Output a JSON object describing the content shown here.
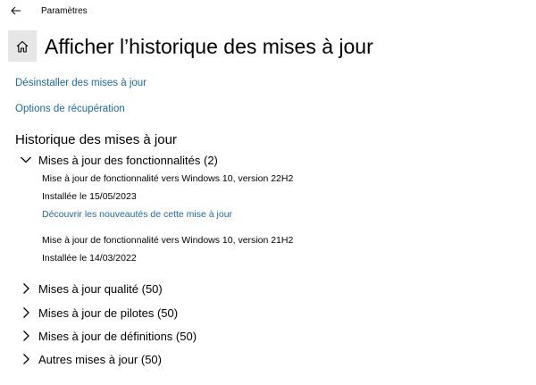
{
  "titlebar": {
    "back_icon": "back-arrow-icon",
    "app_title": "Paramètres"
  },
  "header": {
    "home_icon": "home-icon",
    "title": "Afficher l’historique des mises à jour"
  },
  "links": {
    "uninstall": "Désinstaller des mises à jour",
    "recovery": "Options de récupération"
  },
  "history": {
    "title": "Historique des mises à jour",
    "groups": [
      {
        "label": "Mises à jour des fonctionnalités (2)",
        "expanded": true,
        "items": [
          {
            "name": "Mise à jour de fonctionnalité vers Windows 10, version 22H2",
            "installed": "Installée le 15/05/2023",
            "link": "Découvrir les nouveautés de cette mise à jour"
          },
          {
            "name": "Mise à jour de fonctionnalité vers Windows 10, version 21H2",
            "installed": "Installée le 14/03/2022"
          }
        ]
      },
      {
        "label": "Mises à jour qualité (50)",
        "expanded": false
      },
      {
        "label": "Mises à jour de pilotes (50)",
        "expanded": false
      },
      {
        "label": "Mises à jour de définitions (50)",
        "expanded": false
      },
      {
        "label": "Autres mises à jour (50)",
        "expanded": false
      }
    ]
  },
  "colors": {
    "link": "#1a6aa8",
    "home_tile_bg": "#e6e6e6",
    "background": "#ffffff"
  }
}
